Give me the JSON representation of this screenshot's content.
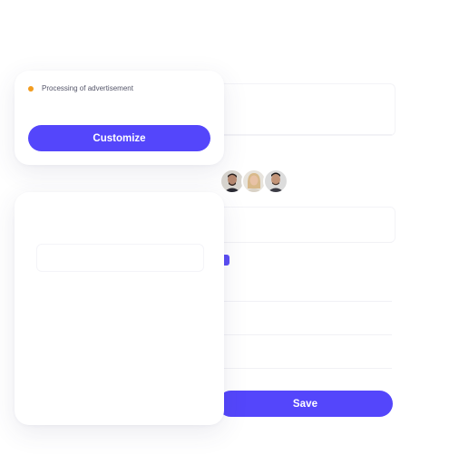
{
  "status_card": {
    "status_text": "Processing of advertisement",
    "status_color": "#f29c1f",
    "customize_label": "Customize"
  },
  "form": {
    "save_label": "Save",
    "accent_color": "#5446fb"
  },
  "avatars": [
    {
      "name": "avatar-person-1-icon"
    },
    {
      "name": "avatar-person-2-icon"
    },
    {
      "name": "avatar-person-3-icon"
    }
  ]
}
